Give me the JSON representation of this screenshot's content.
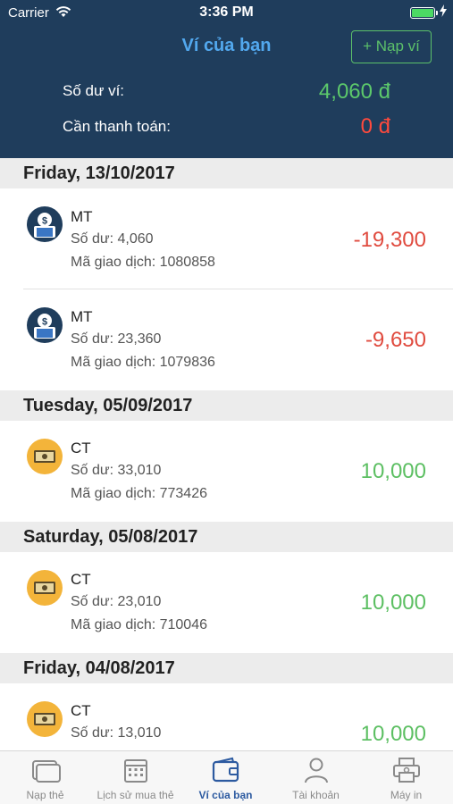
{
  "status_bar": {
    "carrier": "Carrier",
    "time": "3:36 PM"
  },
  "header": {
    "title": "Ví của bạn",
    "topup_button": "+ Nạp ví",
    "balance_label": "Số dư ví:",
    "balance_value": "4,060 đ",
    "due_label": "Cần thanh toán:",
    "due_value": "0 đ"
  },
  "sections": [
    {
      "date": "Friday, 13/10/2017"
    },
    {
      "date": "Tuesday, 05/09/2017"
    },
    {
      "date": "Saturday, 05/08/2017"
    },
    {
      "date": "Friday, 04/08/2017"
    }
  ],
  "transactions": [
    {
      "name": "MT",
      "balance": "Số dư: 4,060",
      "code": "Mã giao dịch: 1080858",
      "amount": "-19,300",
      "icon": "money-bag-icon"
    },
    {
      "name": "MT",
      "balance": "Số dư: 23,360",
      "code": "Mã giao dịch: 1079836",
      "amount": "-9,650",
      "icon": "money-bag-icon"
    },
    {
      "name": "CT",
      "balance": "Số dư: 33,010",
      "code": "Mã giao dịch: 773426",
      "amount": "10,000",
      "icon": "banknote-icon"
    },
    {
      "name": "CT",
      "balance": "Số dư: 23,010",
      "code": "Mã giao dịch: 710046",
      "amount": "10,000",
      "icon": "banknote-icon"
    },
    {
      "name": "CT",
      "balance": "Số dư: 13,010",
      "code": "",
      "amount": "10,000",
      "icon": "banknote-icon"
    }
  ],
  "tabs": [
    {
      "label": "Nạp thẻ",
      "icon": "card-icon"
    },
    {
      "label": "Lịch sử mua thẻ",
      "icon": "calendar-icon"
    },
    {
      "label": "Ví của bạn",
      "icon": "wallet-icon",
      "active": true
    },
    {
      "label": "Tài khoản",
      "icon": "person-icon"
    },
    {
      "label": "Máy in",
      "icon": "printer-icon"
    }
  ],
  "colors": {
    "header_bg": "#1f3d5c",
    "accent_blue": "#52a8ee",
    "positive": "#5cbf62",
    "negative": "#e04b3f",
    "active_tab": "#2c5aa0"
  }
}
